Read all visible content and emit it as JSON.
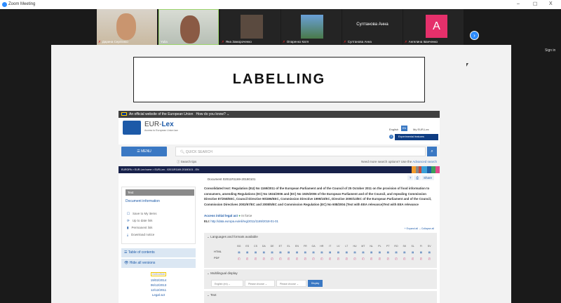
{
  "window": {
    "title": "Zoom Meeting",
    "min": "–",
    "max": "☐",
    "close": "X"
  },
  "participants": [
    {
      "name": "Дарина Сергієнко"
    },
    {
      "name": "Yulia"
    },
    {
      "name": "Яна Замороченко"
    },
    {
      "name": "Опаренко Катя"
    },
    {
      "name": "Султанова Анна",
      "display": "Султанова Анна"
    },
    {
      "name": "Ангелина Іванченко",
      "initial": "A"
    }
  ],
  "gallery_next": "›",
  "sign_in": "Sign in",
  "slide": {
    "title": "LABELLING"
  },
  "eurlex": {
    "banner": "An official website of the European Union",
    "banner_link": "How do you know? ⌄",
    "brand_a": "EUR-",
    "brand_b": "Lex",
    "tagline": "Access to European Union law",
    "lang_label": "English",
    "lang_code": "EN",
    "my_eurlex": "My EUR-Lex",
    "help": "?",
    "experimental": "Experimental features",
    "menu": "☰ MENU",
    "search_placeholder": "QUICK SEARCH",
    "search_tips": "Search tips",
    "adv_text": "Need more search options? Use the ",
    "adv_link": "Advanced search",
    "breadcrumb": "EUROPA > EUR-Lex home > EUR-Lex - 02011R1169-20180101 - EN",
    "sidebar": {
      "text": "Text",
      "doc_info": "Document information",
      "links": [
        "Save to My items",
        "Up to date link",
        "Permanent link",
        "Download notice"
      ],
      "toc": "Table of contents",
      "hide_versions": "Hide all versions",
      "dates": [
        "01/01/2018",
        "19/02/2014",
        "06/12/2013",
        "12/12/2011"
      ],
      "legal_act": "Legal act"
    },
    "main": {
      "doc_no": "Document 02011R1169-20180101",
      "help": "?",
      "print": "⎙",
      "share": "Share",
      "heading": "Consolidated text: Regulation (EU) No 1169/2011 of the European Parliament and of the Council of 25 October 2011 on the provision of food information to consumers, amending Regulations (EC) No 1924/2006 and (EC) No 1925/2006 of the European Parliament and of the Council, and repealing Commission Directive 87/250/EEC, Council Directive 90/496/EEC, Commission Directive 1999/10/EC, Directive 2000/13/EC of the European Parliament and of the Council, Commission Directives 2002/67/EC and 2008/5/EC and Commission Regulation (EC) No 608/2004 (Text with EEA relevance)Text with EEA relevance",
      "access": "Access initial legal act",
      "in_force": "In force",
      "eli_label": "ELI:",
      "eli": "http://data.europa.eu/eli/reg/2011/1169/2018-01-01",
      "expand": "+ Expand all",
      "collapse": "– Collapse all",
      "languages_title": "Languages and formats available",
      "languages": [
        "BG",
        "ES",
        "CS",
        "DA",
        "DE",
        "ET",
        "EL",
        "EN",
        "FR",
        "GA",
        "HR",
        "IT",
        "LV",
        "LT",
        "HU",
        "MT",
        "NL",
        "PL",
        "PT",
        "RO",
        "SK",
        "SL",
        "FI",
        "SV"
      ],
      "html_label": "HTML",
      "pdf_label": "PDF",
      "multilingual_title": "Multilingual display",
      "select1": "English (en)",
      "select2": "Please choose",
      "select3": "Please choose",
      "display": "Display",
      "text_title": "Text"
    }
  }
}
